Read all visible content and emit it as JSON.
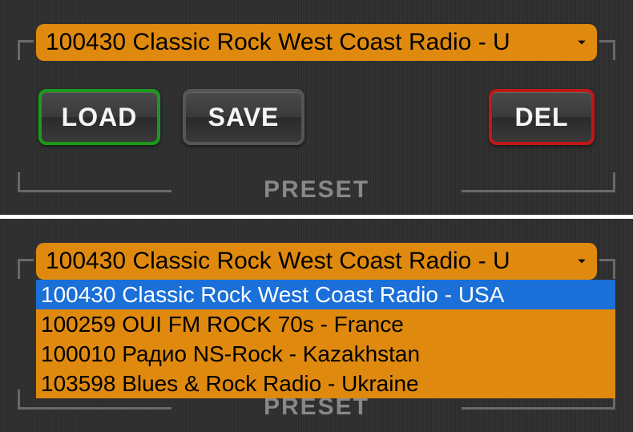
{
  "panel1": {
    "dropdown_selected": "100430 Classic Rock West Coast Radio - U",
    "buttons": {
      "load": "LOAD",
      "save": "SAVE",
      "del": "DEL"
    },
    "section_label": "PRESET"
  },
  "panel2": {
    "dropdown_selected": "100430 Classic Rock West Coast Radio - U",
    "section_label": "PRESET",
    "options": [
      {
        "label": "100430 Classic Rock West Coast Radio - USA",
        "selected": true
      },
      {
        "label": "100259 OUI FM ROCK 70s - France",
        "selected": false
      },
      {
        "label": "100010 Радио NS-Rock - Kazakhstan",
        "selected": false
      },
      {
        "label": "103598 Blues & Rock Radio - Ukraine",
        "selected": false
      }
    ]
  }
}
